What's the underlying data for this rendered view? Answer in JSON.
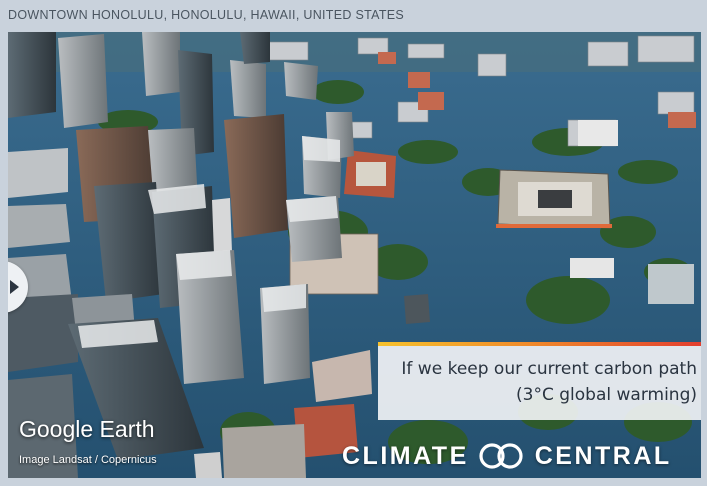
{
  "header": {
    "location": "DOWNTOWN HONOLULU, HONOLULU, HAWAII, UNITED STATES"
  },
  "scenario": {
    "line1": "If we keep our current carbon path",
    "line2": "(3°C global warming)",
    "bar_colors": [
      "#f6c12c",
      "#f08b2a",
      "#e23b2f"
    ]
  },
  "map_credits": {
    "logo_text": "Google Earth",
    "attribution": "Image Landsat / Copernicus"
  },
  "brand": {
    "word1": "CLIMATE",
    "word2": "CENTRAL",
    "mark_icon": "interlocking-circles-icon"
  },
  "navigation": {
    "prev_icon": "play-left-arrow-icon"
  },
  "colors": {
    "water": "#2f5f86",
    "foliage": "#2e5a2c",
    "header_bg": "#c9d2dc"
  }
}
